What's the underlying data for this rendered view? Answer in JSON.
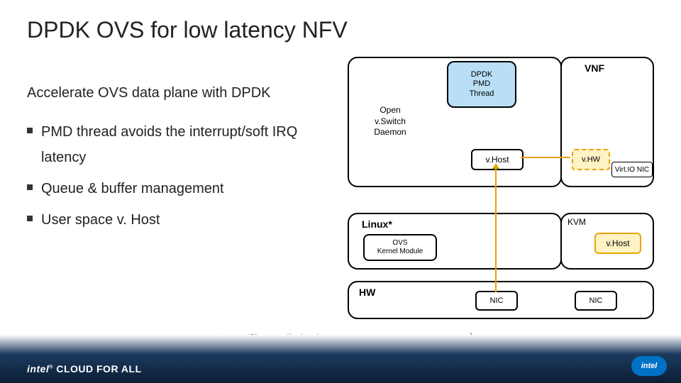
{
  "title": "DPDK OVS for low latency NFV",
  "subtitle": "Accelerate OVS data plane with DPDK",
  "bullets": [
    "PMD thread avoids the interrupt/soft IRQ latency",
    "Queue & buffer management",
    "User space v. Host"
  ],
  "diagram": {
    "ovs_daemon": "Open\nv.Switch\nDaemon",
    "pmd": "DPDK\nPMD\nThread",
    "vhost": "v.Host",
    "vnf": "VNF",
    "vhw": "v.HW",
    "virtio": "Virt.IO NIC",
    "linux": "Linux*",
    "ovs_kernel": "OVS\nKernel Module",
    "kvm": "KVM",
    "vhost2": "v.Host",
    "hw": "HW",
    "nic1": "NIC",
    "nic2": "NIC"
  },
  "footnote": "*Other names and brands may be\nclaimed as the property of others",
  "footer": {
    "brand_left_intel": "intel",
    "brand_left_cfa": " CLOUD FOR ALL",
    "brand_right": "intel"
  }
}
